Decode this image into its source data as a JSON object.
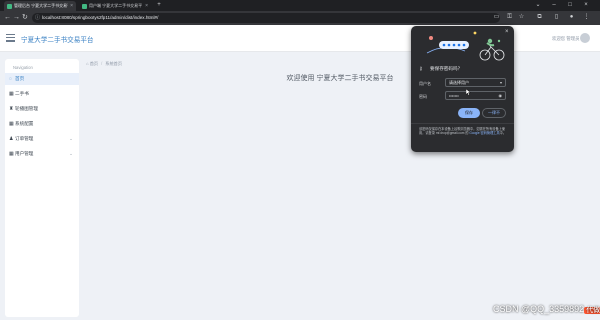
{
  "browser": {
    "tabs": [
      {
        "label": "管理后台 宁夏大学二手书交易平",
        "active": true
      },
      {
        "label": "用户端 宁夏大学二手书交易平",
        "active": false
      }
    ],
    "new_tab": "+",
    "url": "localhost:8080/springbootys2fp11/admin/dist/index.html#/",
    "window_controls": [
      "chevron-down-icon",
      "minimize-icon",
      "maximize-icon",
      "close-icon"
    ]
  },
  "header": {
    "site_title": "宁夏大学二手书交易平台",
    "user_text": "欢迎您 管理员"
  },
  "sidebar": {
    "caption": "Navigation",
    "items": [
      {
        "label": "首页",
        "icon": "home-icon",
        "active": true,
        "expandable": false
      },
      {
        "label": "二手书",
        "icon": "book-icon",
        "active": false,
        "expandable": false
      },
      {
        "label": "轮播图管理",
        "icon": "trophy-icon",
        "active": false,
        "expandable": false
      },
      {
        "label": "系统配置",
        "icon": "grid-icon",
        "active": false,
        "expandable": false
      },
      {
        "label": "订单管理",
        "icon": "user-icon",
        "active": false,
        "expandable": true
      },
      {
        "label": "用户管理",
        "icon": "grid-icon",
        "active": false,
        "expandable": true
      }
    ]
  },
  "breadcrumb": {
    "home": "首页",
    "current": "系统首页"
  },
  "main": {
    "welcome": "欢迎使用 宁夏大学二手书交易平台"
  },
  "password_popup": {
    "title": "要保存密码吗？",
    "username_label": "用户名",
    "username_value": "请选择用户",
    "password_label": "密码",
    "password_value": "•••••••",
    "save_label": "保存",
    "never_label": "一律不",
    "footer_text": "该密码仅保存在本设备上谷歌浏览器中，如需在所有设备上使用，请登录 ",
    "footer_email": "mf.drop@gmail.com",
    "footer_mid": " 的 ",
    "footer_link": "Google 密码管理工具",
    "footer_end": "中。"
  },
  "watermark": {
    "text": "CSDN @QQ_3359892",
    "badge": "代做"
  },
  "colors": {
    "accent": "#3b82c4",
    "popup_bg": "#2b2c2f",
    "save_button": "#8ab4f8"
  }
}
